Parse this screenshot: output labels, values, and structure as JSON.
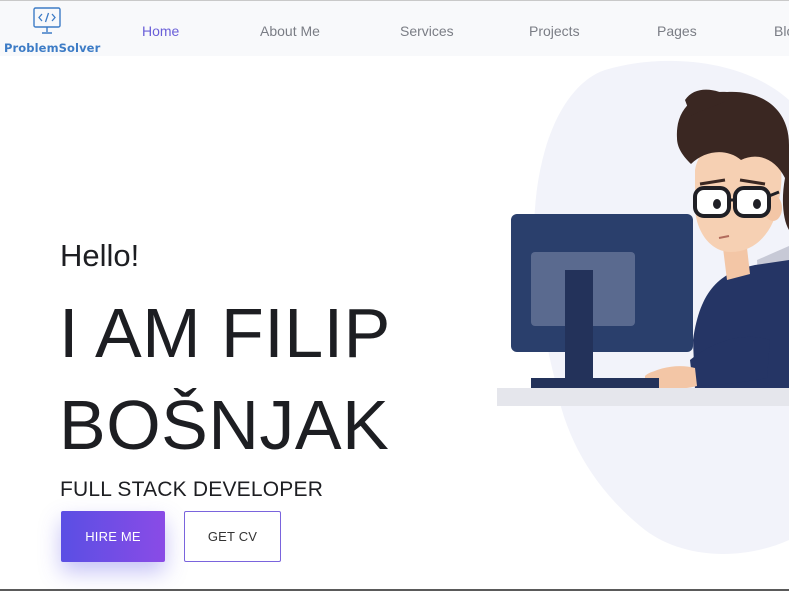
{
  "logo": {
    "brand_name": "ProblemSolver",
    "icon": "code-monitor-icon"
  },
  "nav": {
    "items": [
      {
        "label": "Home",
        "active": true
      },
      {
        "label": "About Me",
        "active": false
      },
      {
        "label": "Services",
        "active": false
      },
      {
        "label": "Projects",
        "active": false
      },
      {
        "label": "Pages",
        "active": false
      },
      {
        "label": "Blo",
        "active": false
      }
    ]
  },
  "hero": {
    "greeting": "Hello!",
    "name_line1": "I AM FILIP",
    "name_line2": "BOŠNJAK",
    "role": "FULL STACK DEVELOPER",
    "hire_label": "HIRE ME",
    "cv_label": "GET CV"
  },
  "colors": {
    "accent": "#6a5fd8",
    "button_gradient_start": "#5a4fe4",
    "button_gradient_end": "#8a4be6",
    "logo_blue": "#3d7cc6"
  },
  "illustration": {
    "subject": "developer-at-computer-illustration"
  }
}
